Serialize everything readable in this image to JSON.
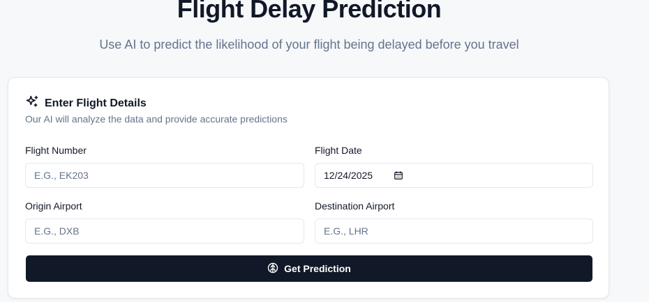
{
  "header": {
    "title": "Flight Delay Prediction",
    "subtitle": "Use AI to predict the likelihood of your flight being delayed before you travel"
  },
  "card": {
    "title": "Enter Flight Details",
    "description": "Our AI will analyze the data and provide accurate predictions",
    "icon": "sparkles-icon"
  },
  "form": {
    "flight_number": {
      "label": "Flight Number",
      "placeholder": "E.G., EK203"
    },
    "flight_date": {
      "label": "Flight Date",
      "value": "12/24/2025",
      "icon": "calendar-icon"
    },
    "origin_airport": {
      "label": "Origin Airport",
      "placeholder": "E.G., DXB"
    },
    "destination_airport": {
      "label": "Destination Airport",
      "placeholder": "E.G., LHR"
    }
  },
  "submit": {
    "label": "Get Prediction",
    "icon": "brain-icon"
  },
  "colors": {
    "background": "#f6f8fa",
    "button_bg": "#111827",
    "muted_text": "#64748b",
    "border": "#e2e8f0"
  }
}
